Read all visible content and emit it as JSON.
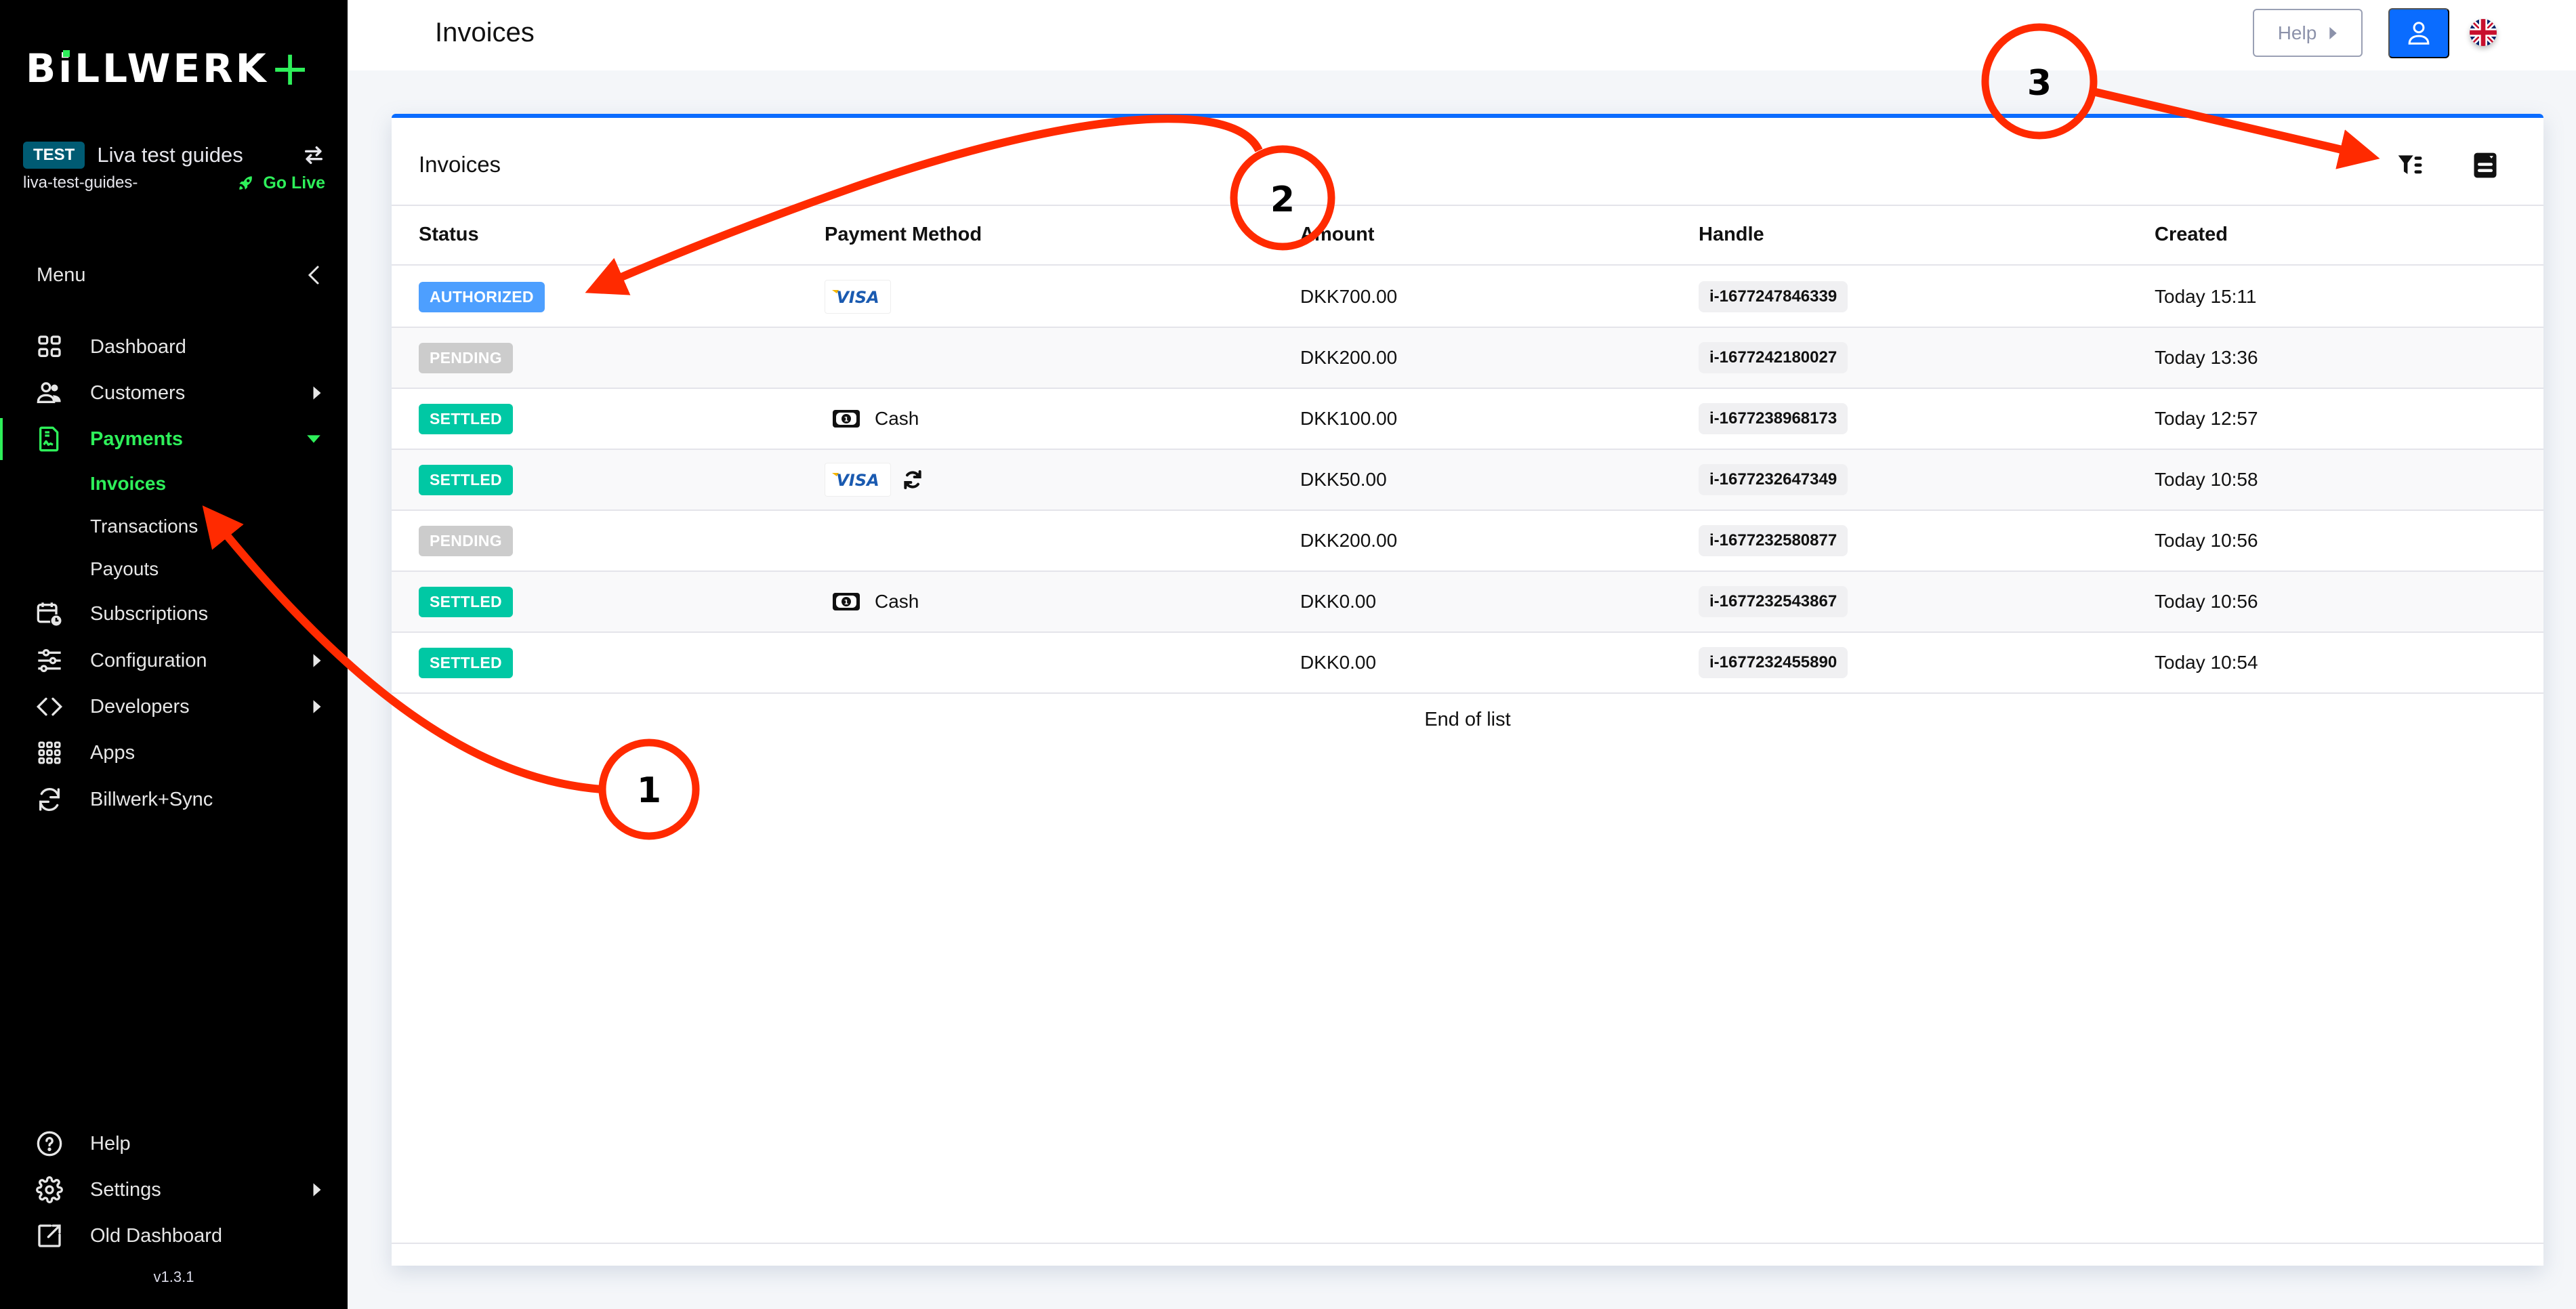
{
  "app": {
    "brand": "BiLLWERK+",
    "brand_main": "BiLLWERK",
    "brand_plus": "+",
    "colors": {
      "accent_green": "#2ef05a",
      "primary_blue": "#0a6cff",
      "test_badge": "#005b73",
      "authorized": "#4d9fff",
      "pending": "#cccccc",
      "settled": "#00c8a4",
      "annotation_red": "#ff2a00"
    }
  },
  "account": {
    "env_badge": "TEST",
    "name": "Liva test guides",
    "handle": "liva-test-guides-",
    "go_live_label": "Go Live",
    "switch_icon": "swap-arrows-icon",
    "go_live_icon": "rocket-icon"
  },
  "sidebar": {
    "menu_label": "Menu",
    "collapse_icon": "chevron-left-icon",
    "items": [
      {
        "label": "Dashboard",
        "icon": "grid-icon",
        "has_submenu": false
      },
      {
        "label": "Customers",
        "icon": "users-icon",
        "has_submenu": true
      },
      {
        "label": "Payments",
        "icon": "receipt-icon",
        "has_submenu": true,
        "active": true,
        "expanded": true,
        "children": [
          {
            "label": "Invoices",
            "active": true
          },
          {
            "label": "Transactions"
          },
          {
            "label": "Payouts"
          }
        ]
      },
      {
        "label": "Subscriptions",
        "icon": "calendar-clock-icon",
        "has_submenu": false
      },
      {
        "label": "Configuration",
        "icon": "sliders-icon",
        "has_submenu": true
      },
      {
        "label": "Developers",
        "icon": "code-icon",
        "has_submenu": true
      },
      {
        "label": "Apps",
        "icon": "apps-grid-icon",
        "has_submenu": false
      },
      {
        "label": "Billwerk+Sync",
        "icon": "sync-icon",
        "has_submenu": false
      }
    ],
    "footer_items": [
      {
        "label": "Help",
        "icon": "help-circle-icon",
        "has_submenu": false
      },
      {
        "label": "Settings",
        "icon": "gear-icon",
        "has_submenu": true
      },
      {
        "label": "Old Dashboard",
        "icon": "external-link-icon",
        "has_submenu": false
      }
    ],
    "version": "v1.3.1"
  },
  "header": {
    "title": "Invoices",
    "help_label": "Help",
    "user_icon": "user-icon",
    "language_icon": "uk-flag-icon"
  },
  "card": {
    "title": "Invoices",
    "filter_icon": "filter-list-icon",
    "columns_icon": "column-settings-icon",
    "columns": [
      "Status",
      "Payment Method",
      "Amount",
      "Handle",
      "Created"
    ],
    "rows": [
      {
        "status": "AUTHORIZED",
        "status_color": "#4d9fff",
        "payment_method": "visa",
        "payment_label": "",
        "recurring": false,
        "amount": "DKK700.00",
        "handle": "i-1677247846339",
        "created": "Today 15:11"
      },
      {
        "status": "PENDING",
        "status_color": "#cccccc",
        "payment_method": "",
        "payment_label": "",
        "recurring": false,
        "amount": "DKK200.00",
        "handle": "i-1677242180027",
        "created": "Today 13:36"
      },
      {
        "status": "SETTLED",
        "status_color": "#00c8a4",
        "payment_method": "cash",
        "payment_label": "Cash",
        "recurring": false,
        "amount": "DKK100.00",
        "handle": "i-1677238968173",
        "created": "Today 12:57"
      },
      {
        "status": "SETTLED",
        "status_color": "#00c8a4",
        "payment_method": "visa",
        "payment_label": "",
        "recurring": true,
        "amount": "DKK50.00",
        "handle": "i-1677232647349",
        "created": "Today 10:58"
      },
      {
        "status": "PENDING",
        "status_color": "#cccccc",
        "payment_method": "",
        "payment_label": "",
        "recurring": false,
        "amount": "DKK200.00",
        "handle": "i-1677232580877",
        "created": "Today 10:56"
      },
      {
        "status": "SETTLED",
        "status_color": "#00c8a4",
        "payment_method": "cash",
        "payment_label": "Cash",
        "recurring": false,
        "amount": "DKK0.00",
        "handle": "i-1677232543867",
        "created": "Today 10:56"
      },
      {
        "status": "SETTLED",
        "status_color": "#00c8a4",
        "payment_method": "",
        "payment_label": "",
        "recurring": false,
        "amount": "DKK0.00",
        "handle": "i-1677232455890",
        "created": "Today 10:54"
      }
    ],
    "end_of_list": "End of list"
  },
  "annotations": [
    {
      "number": "1",
      "points_to": "sidebar Invoices item"
    },
    {
      "number": "2",
      "points_to": "AUTHORIZED status badge"
    },
    {
      "number": "3",
      "points_to": "filter icon"
    }
  ]
}
